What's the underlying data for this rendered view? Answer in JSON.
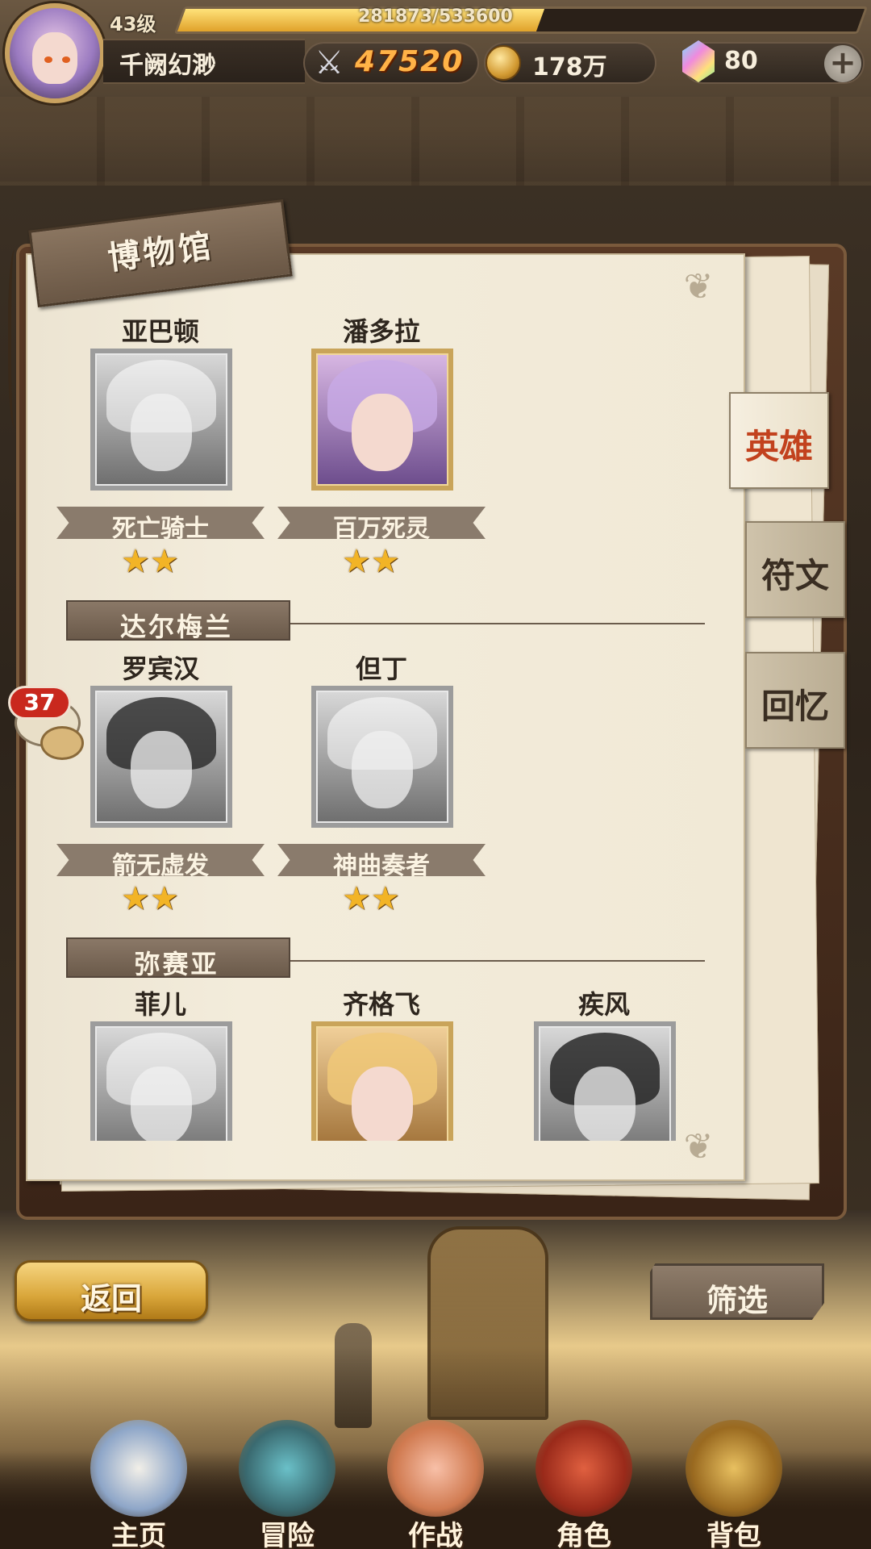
{
  "hud": {
    "level": "43级",
    "exp_text": "281873/533600",
    "exp_fraction": 0.528,
    "player_name": "千阙幻渺",
    "power": "47520",
    "gold": "178万",
    "gems": "80",
    "add_label": "+",
    "icons": {
      "sword": "sword-icon",
      "coin": "coin-icon",
      "gem": "gem-icon"
    }
  },
  "museum": {
    "title": "博物馆",
    "tabs": [
      {
        "label": "英雄",
        "active": true
      },
      {
        "label": "符文",
        "active": false
      },
      {
        "label": "回忆",
        "active": false
      }
    ],
    "sections": [
      {
        "name": "",
        "heroes": [
          {
            "name": "亚巴顿",
            "title": "死亡骑士",
            "stars": "★★",
            "owned": false
          },
          {
            "name": "潘多拉",
            "title": "百万死灵",
            "stars": "★★",
            "owned": true
          }
        ]
      },
      {
        "name": "达尔梅兰",
        "heroes": [
          {
            "name": "罗宾汉",
            "title": "箭无虚发",
            "stars": "★★",
            "owned": false
          },
          {
            "name": "但丁",
            "title": "神曲奏者",
            "stars": "★★",
            "owned": false
          }
        ]
      },
      {
        "name": "弥赛亚",
        "heroes": [
          {
            "name": "菲儿",
            "owned": false
          },
          {
            "name": "齐格飞",
            "owned": true
          },
          {
            "name": "疾风",
            "owned": false
          }
        ]
      }
    ]
  },
  "chat": {
    "unread": "37"
  },
  "buttons": {
    "back": "返回",
    "filter": "筛选"
  },
  "nav": [
    {
      "label": "主页"
    },
    {
      "label": "冒险"
    },
    {
      "label": "作战"
    },
    {
      "label": "角色"
    },
    {
      "label": "背包"
    }
  ]
}
